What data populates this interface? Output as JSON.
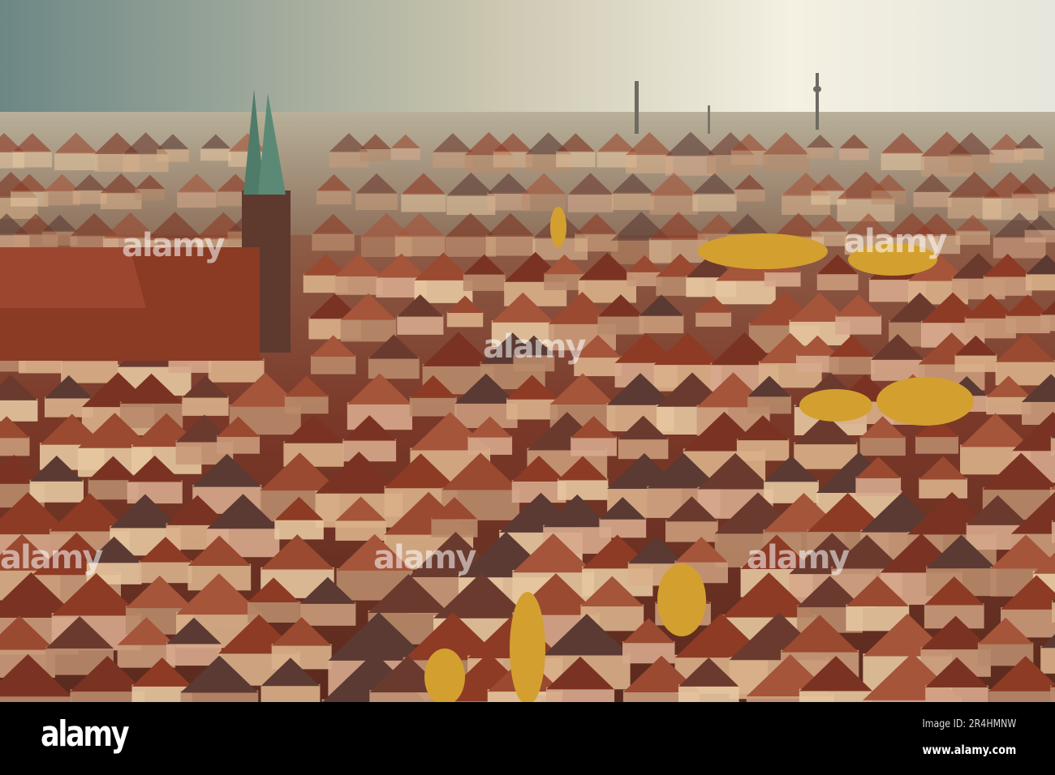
{
  "photo": {
    "subject": "Aerial view of Nuremberg old town rooftops",
    "watermark_text": "alamy"
  },
  "footer": {
    "logo": "alamy",
    "image_id": "Image ID: 2R4HMNW",
    "website": "www.alamy.com"
  },
  "colors": {
    "sky_top": "#6f8a8a",
    "sky_glow": "#f3efe2",
    "haze": "#b9a98f",
    "roof": "#8a3c26",
    "roof_dark": "#4a2a22",
    "tree_gold": "#d9a431",
    "footer_bg": "#000000"
  }
}
